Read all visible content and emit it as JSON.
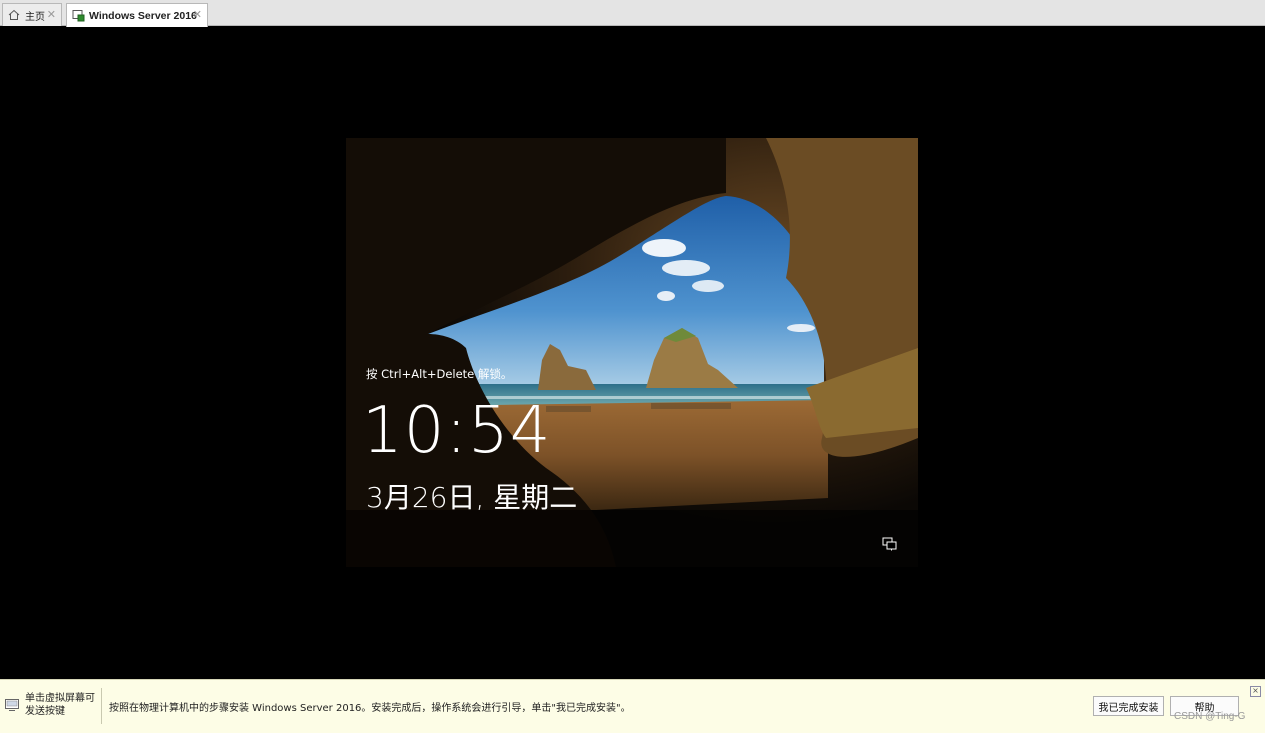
{
  "tabs": [
    {
      "label": "主页",
      "icon": "home-icon",
      "active": false
    },
    {
      "label": "Windows Server 2016",
      "icon": "vm-icon",
      "active": true
    }
  ],
  "vm": {
    "hint": "按 Ctrl+Alt+Delete 解锁。",
    "time": "10:54",
    "date": "3月26日, 星期二",
    "accessory_icon": "network-icon"
  },
  "infobar": {
    "click_hint": "单击虚拟屏幕可发送按键",
    "message": "按照在物理计算机中的步骤安装 Windows Server 2016。安装完成后，操作系统会进行引导，单击\"我已完成安装\"。",
    "done_button": "我已完成安装",
    "help_button": "帮助",
    "dismiss": "×"
  },
  "watermark": "CSDN @Ting-G",
  "colors": {
    "tabbar": "#e4e4e4",
    "infobar": "#fdfde6",
    "screen_bg": "#000000"
  }
}
